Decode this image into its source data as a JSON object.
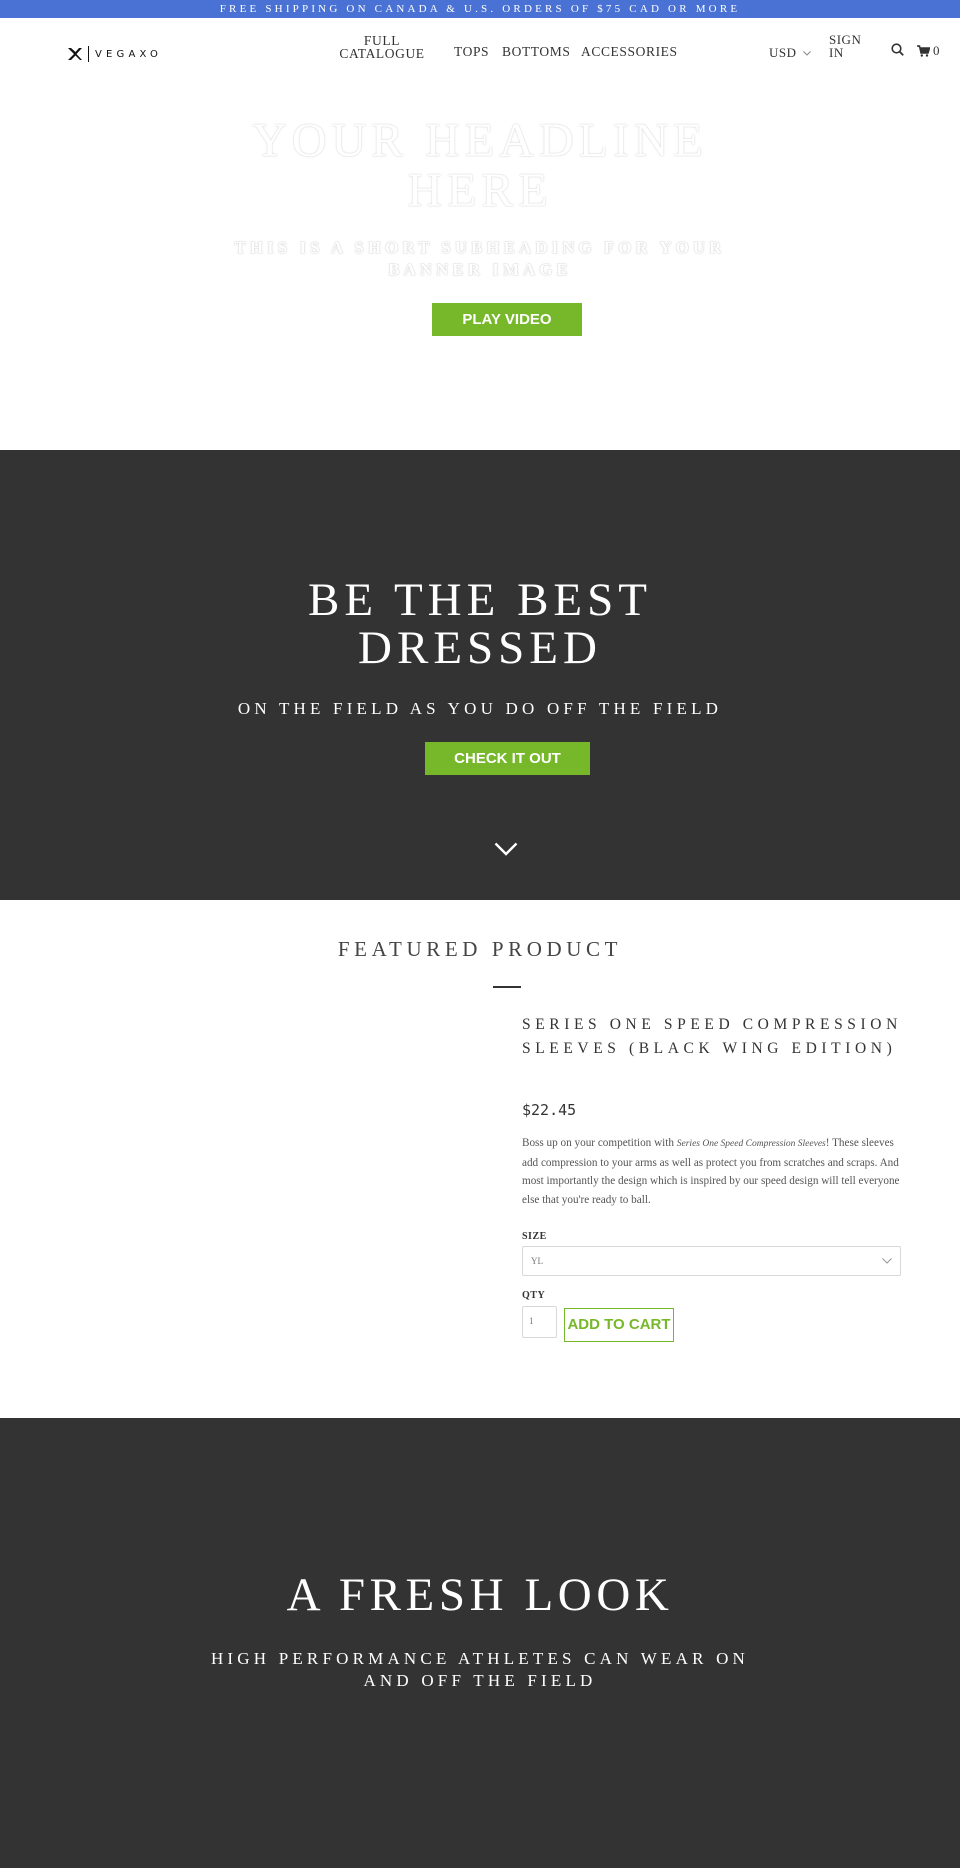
{
  "announcement": "FREE SHIPPING ON CANADA & U.S. ORDERS OF $75 CAD OR MORE",
  "header": {
    "logo_text": "VEGAXO",
    "nav": {
      "full_catalogue": "FULL CATALOGUE",
      "tops": "TOPS",
      "bottoms": "BOTTOMS",
      "accessories": "ACCESSORIES"
    },
    "currency": "USD",
    "sign_in": "SIGN IN",
    "cart_count": "0"
  },
  "hero_banner": {
    "title": "YOUR HEADLINE HERE",
    "subtitle": "THIS IS A SHORT SUBHEADING FOR YOUR BANNER IMAGE",
    "button": "PLAY VIDEO"
  },
  "hero_dark": {
    "title": "BE THE BEST DRESSED",
    "subtitle": "ON THE FIELD AS YOU DO OFF THE FIELD",
    "button": "CHECK IT OUT"
  },
  "featured": {
    "heading": "FEATURED PRODUCT",
    "product_title": "SERIES ONE SPEED COMPRESSION SLEEVES (BLACK WING EDITION)",
    "price": "$22.45",
    "desc_before": "Boss up on your competition with ",
    "desc_italic": "Series One Speed Compression Sleeves",
    "desc_after": "! These sleeves add compression to your arms as well as protect you from scratches and scraps. And most importantly the design which is inspired by our speed design will tell everyone else that you're ready to ball.",
    "size_label": "SIZE",
    "size_value": "YL",
    "qty_label": "QTY",
    "qty_value": "1",
    "add_to_cart": "ADD TO CART"
  },
  "hero_fresh": {
    "title": "A FRESH LOOK",
    "subtitle": "HIGH PERFORMANCE ATHLETES CAN WEAR ON AND OFF THE FIELD"
  },
  "colors": {
    "announcement_bg": "#4a72d4",
    "accent_green": "#76b82a",
    "dark_section": "#333333"
  }
}
